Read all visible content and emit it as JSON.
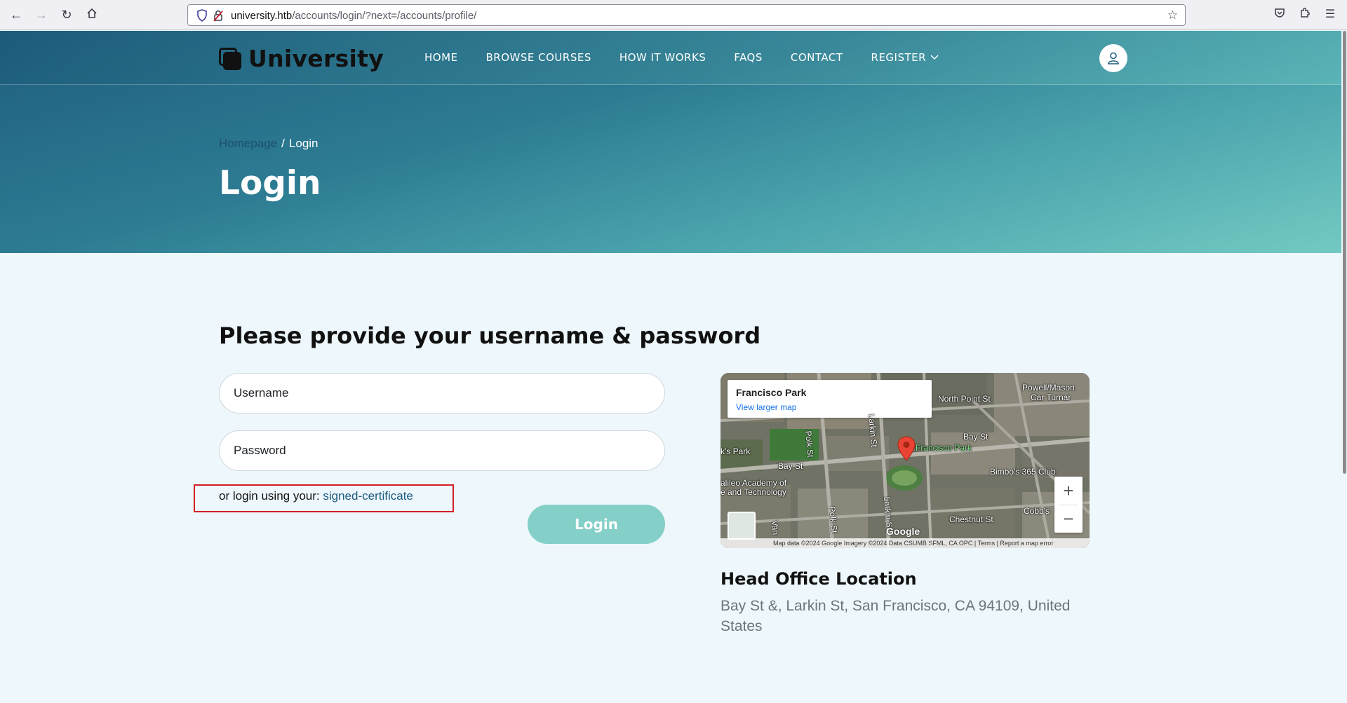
{
  "browser": {
    "url_host": "university.htb",
    "url_path": "/accounts/login/?next=/accounts/profile/"
  },
  "site": {
    "logo_text": "University",
    "nav": [
      "HOME",
      "BROWSE COURSES",
      "HOW IT WORKS",
      "FAQS",
      "CONTACT",
      "REGISTER"
    ]
  },
  "hero": {
    "breadcrumb_home": "Homepage",
    "breadcrumb_sep": "/",
    "breadcrumb_current": "Login",
    "title": "Login"
  },
  "form": {
    "heading": "Please provide your username & password",
    "username_placeholder": "Username",
    "password_placeholder": "Password",
    "alt_login_prefix": "or login using your: ",
    "alt_login_link": "signed-certificate",
    "submit_label": "Login"
  },
  "map": {
    "place_name": "Francisco Park",
    "larger_map": "View larger map",
    "labels": {
      "north_point": "North Point St",
      "powell": "Powell/Mason",
      "car_turn": "Car Turnar",
      "bay_st_right": "Bay St",
      "bay_st_left": "Bay St",
      "polk_st": "Polk St",
      "larkin_st": "Larkin St",
      "francisco_park": "Francisco Park",
      "bimbos": "Bimbo's 365 Club",
      "academy": "alileo Academy of",
      "technology": "e and Technology",
      "chestnut": "Chestnut St",
      "cobbs": "Cobb's",
      "van": "Van",
      "polk_bottom": "Polk St",
      "larkin_bottom": "Larkin St",
      "park_left": "k's Park"
    },
    "google": "Google",
    "footer": "Map data ©2024 Google Imagery ©2024 Data CSUMB SFML, CA OPC  |  Terms  |  Report a map error",
    "zoom_in": "+",
    "zoom_out": "−"
  },
  "office": {
    "title": "Head Office Location",
    "address": "Bay St &, Larkin St, San Francisco, CA 94109, United States"
  }
}
